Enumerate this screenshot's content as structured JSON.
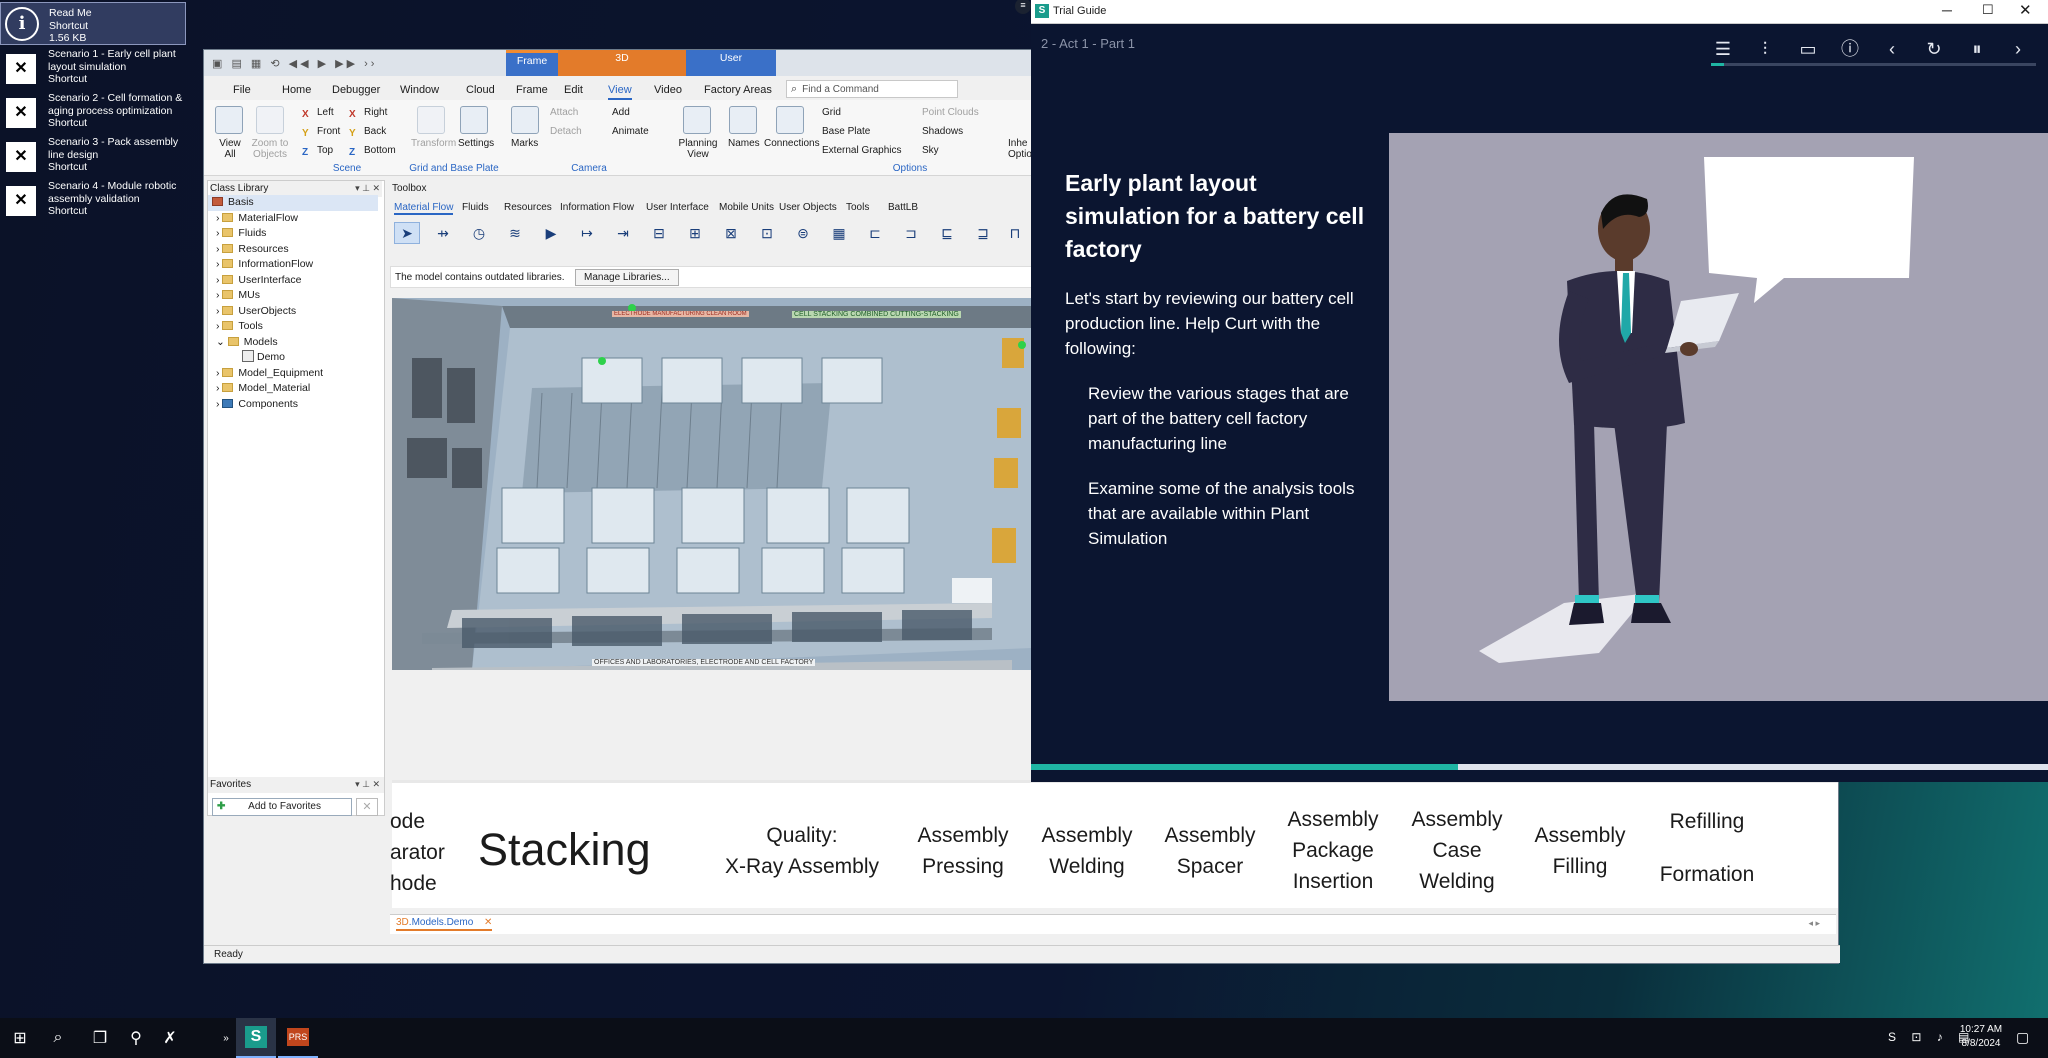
{
  "desktop": {
    "icons": [
      {
        "name": "Read Me",
        "sub1": "Shortcut",
        "sub2": "1.56 KB"
      },
      {
        "name": "Scenario 1 - Early cell plant layout simulation",
        "sub1": "Shortcut",
        "sub2": ""
      },
      {
        "name": "Scenario 2 - Cell formation & aging process optimization",
        "sub1": "Shortcut",
        "sub2": ""
      },
      {
        "name": "Scenario 3 - Pack assembly line design",
        "sub1": "Shortcut",
        "sub2": ""
      },
      {
        "name": "Scenario 4 - Module robotic assembly validation",
        "sub1": "Shortcut",
        "sub2": ""
      }
    ]
  },
  "plantsim": {
    "context_tabs": {
      "group1": "Frame",
      "group2": "3D",
      "group3": "User"
    },
    "menu_tabs": [
      "File",
      "Home",
      "Debugger",
      "Window",
      "Cloud",
      "Frame",
      "Edit",
      "View",
      "Video",
      "Factory Areas"
    ],
    "active_menu": "View",
    "search_placeholder": "Find a Command",
    "ribbon": {
      "view_all": "View All",
      "zoom_to_objects": "Zoom to Objects",
      "left": "Left",
      "right": "Right",
      "front": "Front",
      "back": "Back",
      "top": "Top",
      "bottom": "Bottom",
      "transform": "Transform",
      "settings": "Settings",
      "marks": "Marks",
      "attach": "Attach",
      "detach": "Detach",
      "add": "Add",
      "animate": "Animate",
      "planning_view": "Planning View",
      "names": "Names",
      "connections": "Connections",
      "grid": "Grid",
      "base_plate": "Base Plate",
      "external_graphics": "External Graphics",
      "point_clouds": "Point Clouds",
      "shadows": "Shadows",
      "sky": "Sky",
      "inherit_options": "Inhe Optio",
      "groups": {
        "scene": "Scene",
        "grid_base": "Grid and Base Plate",
        "camera": "Camera",
        "options": "Options"
      }
    },
    "class_library": {
      "title": "Class Library",
      "items": [
        "Basis",
        "MaterialFlow",
        "Fluids",
        "Resources",
        "InformationFlow",
        "UserInterface",
        "MUs",
        "UserObjects",
        "Tools",
        "Models",
        "Demo",
        "Model_Equipment",
        "Model_Material",
        "Components"
      ]
    },
    "toolbox": {
      "title": "Toolbox",
      "tabs": [
        "Material Flow",
        "Fluids",
        "Resources",
        "Information Flow",
        "User Interface",
        "Mobile Units",
        "User Objects",
        "Tools",
        "BattLB"
      ],
      "active_tab": "Material Flow"
    },
    "notice": {
      "text": "The model contains outdated libraries.",
      "button": "Manage Libraries..."
    },
    "favorites": {
      "title": "Favorites",
      "add_label": "Add to Favorites"
    },
    "doc_tab": {
      "prefix": "3D",
      "label": ".Models.Demo"
    },
    "status": "Ready",
    "view_labels": {
      "top1": "CELL STACKING COMBINED CUTTING-STACKING",
      "top2": "ELECTRODE MANUFACTURING CLEAN ROOM",
      "bottom": "OFFICES AND LABORATORIES, ELECTRODE AND CELL FACTORY"
    },
    "banner": {
      "cut1": "ode",
      "cut2": "arator",
      "cut3": "hode",
      "stacking": "Stacking",
      "quality1": "Quality:",
      "quality2": "X-Ray Assembly",
      "pressing1": "Assembly",
      "pressing2": "Pressing",
      "welding1": "Assembly",
      "welding2": "Welding",
      "spacer1": "Assembly",
      "spacer2": "Spacer",
      "package1": "Assembly",
      "package2": "Package",
      "package3": "Insertion",
      "case1": "Assembly",
      "case2": "Case",
      "case3": "Welding",
      "filling1": "Assembly",
      "filling2": "Filling",
      "refilling": "Refilling",
      "formation": "Formation"
    }
  },
  "trial_guide": {
    "window_title": "Trial Guide",
    "breadcrumb": "2 - Act 1 - Part 1",
    "heading": "Early plant layout simulation for a battery cell factory",
    "intro": "Let's start by reviewing our battery cell production line. Help Curt with the following:",
    "bullets": [
      "Review the various stages that are part of the battery cell factory manufacturing line",
      "Examine some of the analysis tools that are available within Plant Simulation"
    ],
    "progress_top": 0.04,
    "progress_bottom": 0.42
  },
  "taskbar": {
    "time": "10:27 AM",
    "date": "8/8/2024"
  },
  "colors": {
    "accent_blue": "#2a66c4",
    "teal": "#1fb5a3",
    "guide_bg": "#0b1530",
    "slide_panel": "#a4a2b3"
  }
}
